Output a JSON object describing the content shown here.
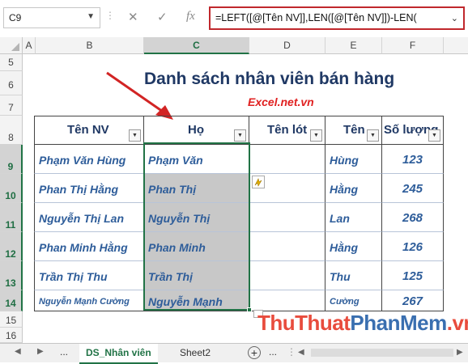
{
  "formula_bar": {
    "name_box": "C9",
    "cancel_icon": "✕",
    "enter_icon": "✓",
    "fx_label": "fx",
    "formula": "=LEFT([@[Tên NV]],LEN([@[Tên NV]])-LEN("
  },
  "columns": [
    "A",
    "B",
    "C",
    "D",
    "E",
    "F"
  ],
  "rows": [
    "5",
    "6",
    "7",
    "8",
    "9",
    "10",
    "11",
    "12",
    "13",
    "14",
    "15",
    "16"
  ],
  "sheet": {
    "title": "Danh sách nhân viên bán hàng",
    "site": "Excel.net.vn"
  },
  "table": {
    "headers": [
      "Tên NV",
      "Họ",
      "Tên lót",
      "Tên",
      "Số lượng"
    ],
    "rows": [
      {
        "ten_nv": "Phạm Văn Hùng",
        "ho": "Phạm Văn",
        "ten_lot": "",
        "ten": "Hùng",
        "so_luong": "123"
      },
      {
        "ten_nv": "Phan Thị Hằng",
        "ho": "Phan Thị",
        "ten_lot": "",
        "ten": "Hằng",
        "so_luong": "245"
      },
      {
        "ten_nv": "Nguyễn Thị Lan",
        "ho": "Nguyễn Thị",
        "ten_lot": "",
        "ten": "Lan",
        "so_luong": "268"
      },
      {
        "ten_nv": "Phan Minh Hằng",
        "ho": "Phan Minh",
        "ten_lot": "",
        "ten": "Hằng",
        "so_luong": "126"
      },
      {
        "ten_nv": "Trần Thị Thu",
        "ho": "Trần Thị",
        "ten_lot": "",
        "ten": "Thu",
        "so_luong": "125"
      },
      {
        "ten_nv": "Nguyễn Mạnh Cường",
        "ho": "Nguyễn Mạnh",
        "ten_lot": "",
        "ten": "Cường",
        "so_luong": "267"
      }
    ]
  },
  "tabs": {
    "ellipsis": "...",
    "active": "DS_Nhân viên",
    "other": "Sheet2",
    "add": "+"
  },
  "watermark": {
    "part1": "ThuThuat",
    "part2": "PhanMem",
    "part3": ".vn"
  },
  "colors": {
    "accent": "#217346",
    "title": "#1f3864",
    "data_text": "#2e5d9a",
    "site_text": "#e02020",
    "selected_fill": "#c8c8c8"
  }
}
